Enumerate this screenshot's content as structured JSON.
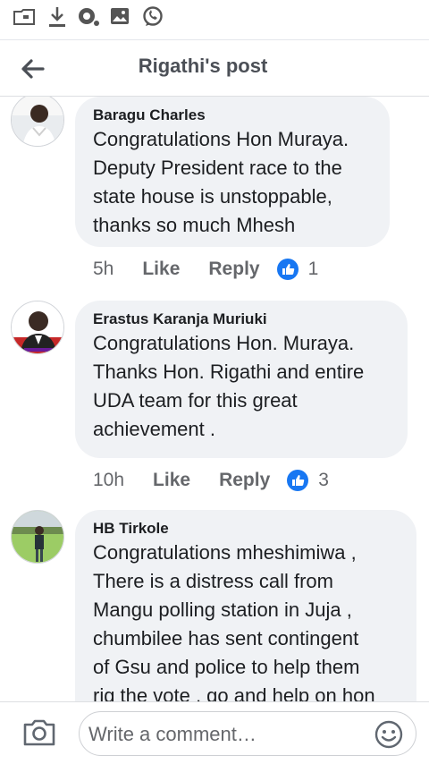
{
  "header": {
    "title": "Rigathi's post"
  },
  "comments": [
    {
      "author": "Baragu Charles",
      "text": "Congratulations Hon Muraya.\nDeputy President race to the\nstate house is unstoppable,\nthanks so much Mhesh",
      "time": "5h",
      "like_label": "Like",
      "reply_label": "Reply",
      "reactions": "1"
    },
    {
      "author": "Erastus Karanja Muriuki",
      "text": "Congratulations Hon. Muraya.\nThanks Hon. Rigathi and entire\nUDA team for this great\nachievement .",
      "time": "10h",
      "like_label": "Like",
      "reply_label": "Reply",
      "reactions": "3"
    },
    {
      "author": "HB Tirkole",
      "text": "Congratulations mheshimiwa ,\nThere is  a distress call from\nMangu polling station in Juja ,\nchumbilee has sent contingent\nof Gsu and police to help them\nrig the vote , go and help on hon"
    }
  ],
  "composer": {
    "placeholder": "Write a comment…"
  },
  "colors": {
    "like_blue": "#1877f2",
    "bubble_bg": "#f0f2f5",
    "secondary_text": "#65676b"
  },
  "icons": [
    "folder-icon",
    "download-icon",
    "camera-lens-icon",
    "image-icon",
    "whatsapp-icon",
    "back-arrow-icon",
    "like-reaction-icon",
    "camera-icon",
    "emoji-icon"
  ]
}
